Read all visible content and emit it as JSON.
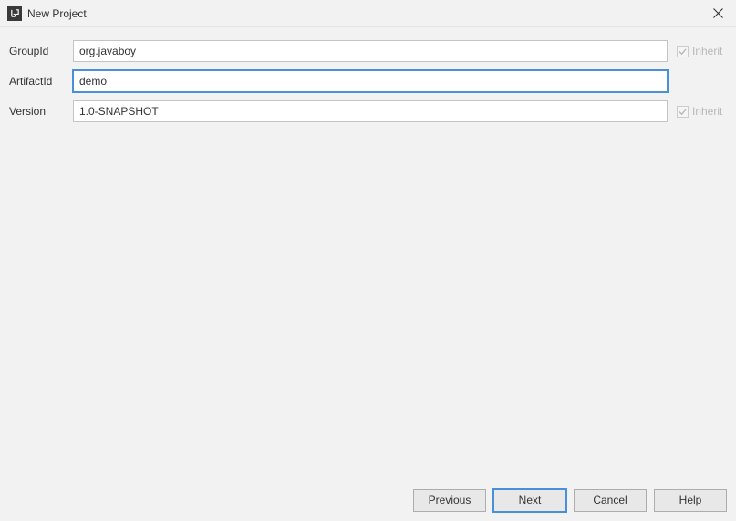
{
  "window": {
    "title": "New Project"
  },
  "form": {
    "groupId": {
      "label": "GroupId",
      "value": "org.javaboy",
      "inherit_label": "Inherit",
      "inherit_checked": true
    },
    "artifactId": {
      "label": "ArtifactId",
      "value": "demo"
    },
    "version": {
      "label": "Version",
      "value": "1.0-SNAPSHOT",
      "inherit_label": "Inherit",
      "inherit_checked": true
    }
  },
  "buttons": {
    "previous": "Previous",
    "next": "Next",
    "cancel": "Cancel",
    "help": "Help"
  }
}
